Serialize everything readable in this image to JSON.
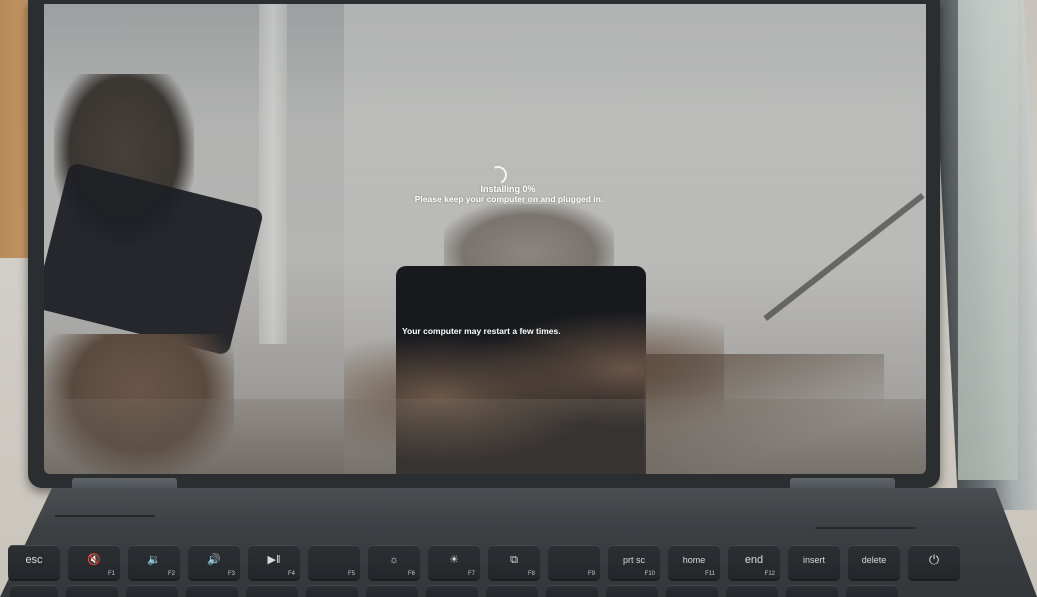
{
  "screen": {
    "install_status": "Installing  0%",
    "install_note": "Please keep your computer on and plugged in.",
    "restart_note": "Your computer may restart a few times."
  },
  "keyboard": {
    "function_row": [
      {
        "main": "esc",
        "sub": "",
        "icon": ""
      },
      {
        "main": "",
        "sub": "F1",
        "icon": "mute-icon"
      },
      {
        "main": "",
        "sub": "F2",
        "icon": "volume-down-icon"
      },
      {
        "main": "",
        "sub": "F3",
        "icon": "volume-up-icon"
      },
      {
        "main": "",
        "sub": "F4",
        "icon": "play-pause-icon"
      },
      {
        "main": "",
        "sub": "F5",
        "icon": ""
      },
      {
        "main": "",
        "sub": "F6",
        "icon": "brightness-down-icon"
      },
      {
        "main": "",
        "sub": "F7",
        "icon": "brightness-up-icon"
      },
      {
        "main": "",
        "sub": "F8",
        "icon": "display-switch-icon"
      },
      {
        "main": "",
        "sub": "F9",
        "icon": ""
      },
      {
        "main": "prt sc",
        "sub": "F10",
        "icon": ""
      },
      {
        "main": "home",
        "sub": "F11",
        "icon": ""
      },
      {
        "main": "end",
        "sub": "F12",
        "icon": ""
      },
      {
        "main": "insert",
        "sub": "",
        "icon": ""
      },
      {
        "main": "delete",
        "sub": "",
        "icon": ""
      },
      {
        "main": "",
        "sub": "",
        "icon": "power-icon"
      }
    ]
  },
  "colors": {
    "screen_text": "#ffffff",
    "bezel": "#2b2e31",
    "key": "#262a2d"
  }
}
